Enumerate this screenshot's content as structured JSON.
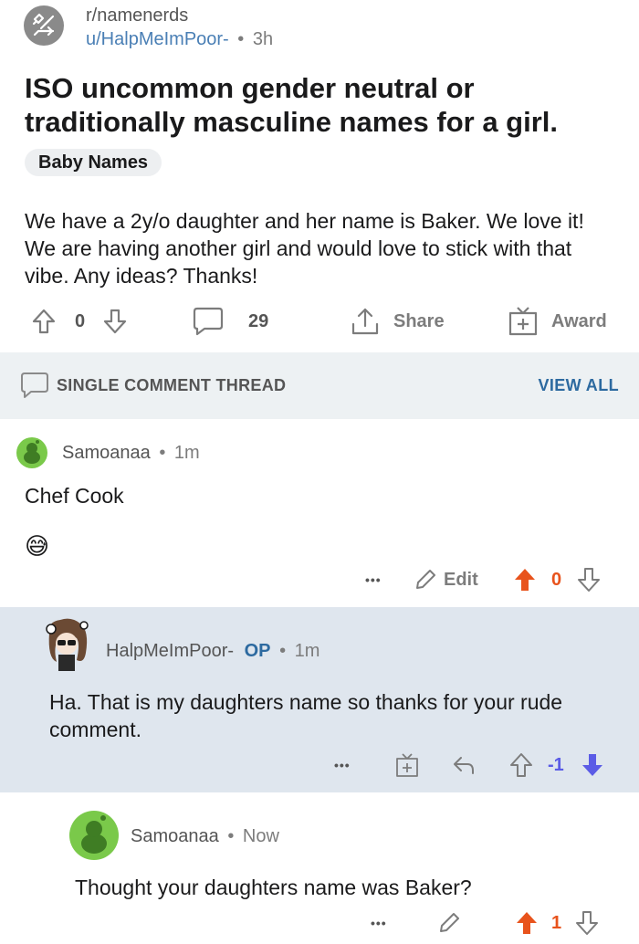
{
  "post": {
    "subreddit": "r/namenerds",
    "author": "u/HalpMeImPoor-",
    "separator": "•",
    "age": "3h",
    "title": "ISO uncommon gender neutral or traditionally masculine names for a girl.",
    "flair": "Baby Names",
    "body": "We have a 2y/o daughter and her name is Baker. We love it! We are having another girl and would love to stick with that vibe. Any ideas? Thanks!",
    "votes": "0",
    "comment_count": "29",
    "share_label": "Share",
    "award_label": "Award"
  },
  "thread_bar": {
    "label": "SINGLE COMMENT THREAD",
    "view_all": "VIEW ALL"
  },
  "comments": [
    {
      "author": "Samoanaa",
      "separator": "•",
      "age": "1m",
      "text": "Chef Cook",
      "emoji": "😅",
      "more": "•••",
      "edit_label": "Edit",
      "votes": "0"
    },
    {
      "author": "HalpMeImPoor-",
      "op_tag": "OP",
      "separator": "•",
      "age": "1m",
      "text": "Ha. That is my daughters name so thanks for your rude comment.",
      "more": "•••",
      "votes": "-1"
    },
    {
      "author": "Samoanaa",
      "separator": "•",
      "age": "Now",
      "text": "Thought your daughters name was Baker?",
      "more": "•••",
      "votes": "1"
    }
  ],
  "colors": {
    "upvote": "#e8531c",
    "downvote": "#5b5ce6",
    "link": "#2d6aa0",
    "snoo_green": "#7ac94a"
  }
}
